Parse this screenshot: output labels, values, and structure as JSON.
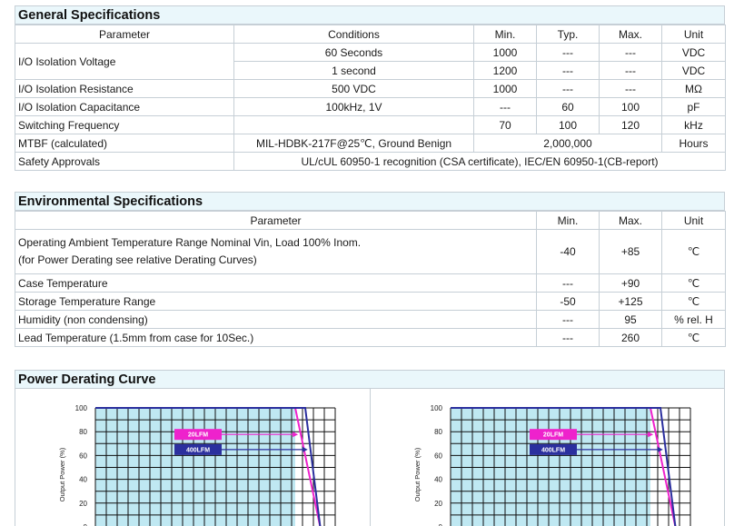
{
  "general": {
    "title": "General Specifications",
    "headers": [
      "Parameter",
      "Conditions",
      "Min.",
      "Typ.",
      "Max.",
      "Unit"
    ],
    "iso_voltage": {
      "param": "I/O Isolation Voltage",
      "row1": {
        "cond": "60 Seconds",
        "min": "1000",
        "typ": "---",
        "max": "---",
        "unit": "VDC"
      },
      "row2": {
        "cond": "1 second",
        "min": "1200",
        "typ": "---",
        "max": "---",
        "unit": "VDC"
      }
    },
    "iso_resistance": {
      "param": "I/O Isolation Resistance",
      "cond": "500 VDC",
      "min": "1000",
      "typ": "---",
      "max": "---",
      "unit": "MΩ"
    },
    "iso_capacitance": {
      "param": "I/O Isolation Capacitance",
      "cond": "100kHz, 1V",
      "min": "---",
      "typ": "60",
      "max": "100",
      "unit": "pF"
    },
    "switching": {
      "param": "Switching Frequency",
      "cond": "",
      "min": "70",
      "typ": "100",
      "max": "120",
      "unit": "kHz"
    },
    "mtbf": {
      "param": "MTBF (calculated)",
      "cond": "MIL-HDBK-217F@25℃, Ground Benign",
      "value": "2,000,000",
      "unit": "Hours"
    },
    "safety": {
      "param": "Safety Approvals",
      "value": "UL/cUL 60950-1 recognition (CSA certificate), IEC/EN 60950-1(CB-report)"
    }
  },
  "environmental": {
    "title": "Environmental Specifications",
    "headers": [
      "Parameter",
      "Min.",
      "Max.",
      "Unit"
    ],
    "ambient": {
      "line1": "Operating Ambient Temperature Range Nominal Vin, Load 100% Inom.",
      "line2": "(for Power Derating see relative Derating Curves)",
      "min": "-40",
      "max": "+85",
      "unit": "℃"
    },
    "case": {
      "param": "Case Temperature",
      "min": "---",
      "max": "+90",
      "unit": "℃"
    },
    "storage": {
      "param": "Storage Temperature Range",
      "min": "-50",
      "max": "+125",
      "unit": "℃"
    },
    "humidity": {
      "param": "Humidity (non condensing)",
      "min": "---",
      "max": "95",
      "unit": "% rel. H"
    },
    "lead": {
      "param": "Lead Temperature (1.5mm from case for 10Sec.)",
      "min": "---",
      "max": "260",
      "unit": "℃"
    }
  },
  "derating": {
    "title": "Power Derating Curve",
    "colors": {
      "lfm20": "#ee22cc",
      "lfm400": "#2b2f9e",
      "safe_area": "#bfe8f2"
    },
    "chart_data": [
      {
        "type": "line",
        "ylabel": "Output Power (%)",
        "ylim": [
          0,
          100
        ],
        "yticks": [
          0,
          20,
          40,
          60,
          80,
          100
        ],
        "legend": [
          "20LFM",
          "400LFM"
        ],
        "series": [
          {
            "name": "20LFM",
            "x": [
              0,
              80,
              90
            ],
            "y": [
              100,
              100,
              0
            ]
          },
          {
            "name": "400LFM",
            "x": [
              0,
              84,
              90
            ],
            "y": [
              100,
              100,
              0
            ]
          }
        ]
      },
      {
        "type": "line",
        "ylabel": "Output Power (%)",
        "ylim": [
          0,
          100
        ],
        "yticks": [
          0,
          20,
          40,
          60,
          80,
          100
        ],
        "legend": [
          "20LFM",
          "400LFM"
        ],
        "series": [
          {
            "name": "20LFM",
            "x": [
              0,
              80,
              90
            ],
            "y": [
              100,
              100,
              0
            ]
          },
          {
            "name": "400LFM",
            "x": [
              0,
              84,
              90
            ],
            "y": [
              100,
              100,
              0
            ]
          }
        ]
      }
    ]
  }
}
